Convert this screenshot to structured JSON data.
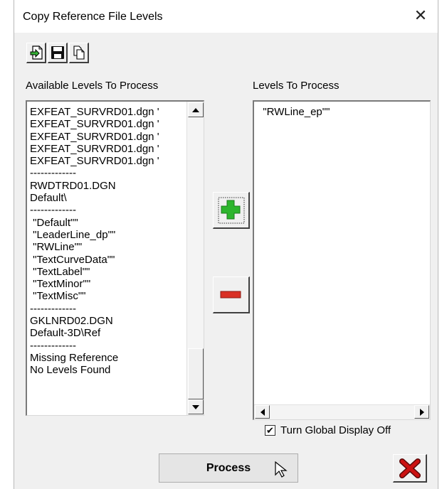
{
  "window": {
    "title": "Copy Reference File Levels",
    "close_glyph": "✕"
  },
  "toolbar": {
    "buttons": [
      {
        "icon": "import-arrow-icon"
      },
      {
        "icon": "save-floppy-icon"
      },
      {
        "icon": "copy-document-icon"
      }
    ]
  },
  "left_panel": {
    "label": "Available Levels To Process",
    "items": [
      "EXFEAT_SURVRD01.dgn '",
      "EXFEAT_SURVRD01.dgn '",
      "EXFEAT_SURVRD01.dgn '",
      "EXFEAT_SURVRD01.dgn '",
      "EXFEAT_SURVRD01.dgn '",
      "-------------",
      "RWDTRD01.DGN",
      "Default\\",
      "-------------",
      " \"Default\"\"",
      " \"LeaderLine_dp\"\"",
      " \"RWLine\"\"",
      " \"TextCurveData\"\"",
      " \"TextLabel\"\"",
      " \"TextMinor\"\"",
      " \"TextMisc\"\"",
      "-------------",
      "GKLNRD02.DGN",
      "Default-3D\\Ref",
      "-------------",
      "Missing Reference",
      "No Levels Found"
    ]
  },
  "right_panel": {
    "label": "Levels To Process",
    "items": [
      "  \"RWLine_ep\"\""
    ]
  },
  "buttons": {
    "add_icon": "plus-icon",
    "remove_icon": "minus-icon",
    "process_label": "Process",
    "cancel_icon": "red-x-icon"
  },
  "options": {
    "global_display_label": "Turn Global Display Off",
    "global_display_checked": true,
    "check_glyph": "✔"
  },
  "colors": {
    "plus_green": "#2db52d",
    "minus_red": "#d93025",
    "cancel_red": "#cc1111"
  }
}
